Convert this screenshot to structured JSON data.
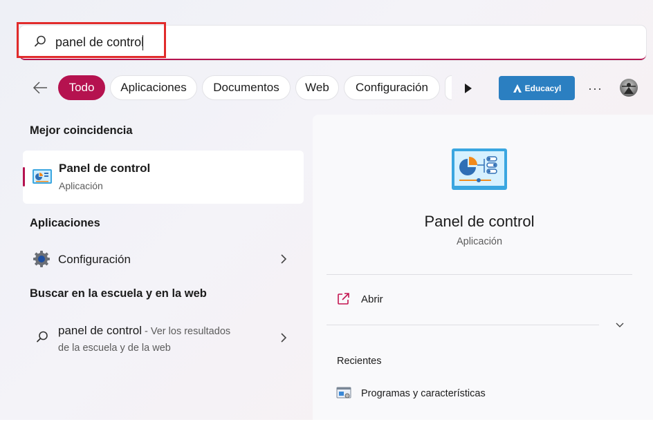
{
  "search": {
    "value": "panel de control",
    "icon": "search-icon"
  },
  "filters": {
    "back_icon": "back-arrow-icon",
    "chips": [
      "Todo",
      "Aplicaciones",
      "Documentos",
      "Web",
      "Configuración"
    ],
    "active_chip": "Todo",
    "active_color": "#b5124f",
    "more_icon": "play-icon",
    "educacyl_label": "Educacyl",
    "educacyl_color": "#2b7fc1",
    "more_options": "···"
  },
  "left": {
    "best_match_heading": "Mejor coincidencia",
    "best_match": {
      "title": "Panel de control",
      "subtitle": "Aplicación",
      "icon": "control-panel-icon"
    },
    "apps_heading": "Aplicaciones",
    "apps": [
      {
        "label": "Configuración",
        "icon": "gear-icon"
      }
    ],
    "web_heading": "Buscar en la escuela y en la web",
    "web_result": {
      "query": "panel de control",
      "suffix": " - Ver los resultados",
      "line2": "de la escuela y de la web",
      "icon": "search-icon"
    }
  },
  "detail": {
    "title": "Panel de control",
    "subtitle": "Aplicación",
    "icon": "control-panel-icon",
    "open_label": "Abrir",
    "open_icon": "open-external-icon",
    "recent_heading": "Recientes",
    "recent_items": [
      {
        "label": "Programas y características",
        "icon": "programs-features-icon"
      }
    ]
  }
}
